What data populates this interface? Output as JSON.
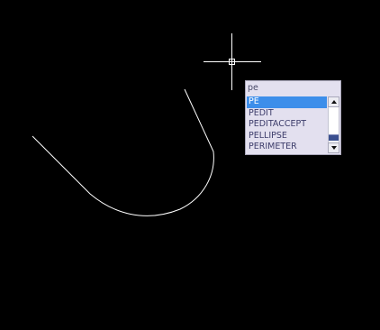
{
  "workspace": {
    "background_color": "#000000",
    "geometry_color": "#ffffff",
    "crosshair_color": "#ffffff"
  },
  "command_line": {
    "typed_text": "pe"
  },
  "autocomplete": {
    "items": [
      {
        "label": "PE",
        "selected": true
      },
      {
        "label": "PEDIT",
        "selected": false
      },
      {
        "label": "PEDITACCEPT",
        "selected": false
      },
      {
        "label": "PELLIPSE",
        "selected": false
      },
      {
        "label": "PERIMETER",
        "selected": false
      }
    ],
    "selection_color": "#3d8eea",
    "background_color": "#e3e0ef"
  },
  "icons": {
    "cursor": "crosshair-cursor-icon",
    "scroll_up": "scroll-up-arrow-icon",
    "scroll_down": "scroll-down-arrow-icon"
  }
}
